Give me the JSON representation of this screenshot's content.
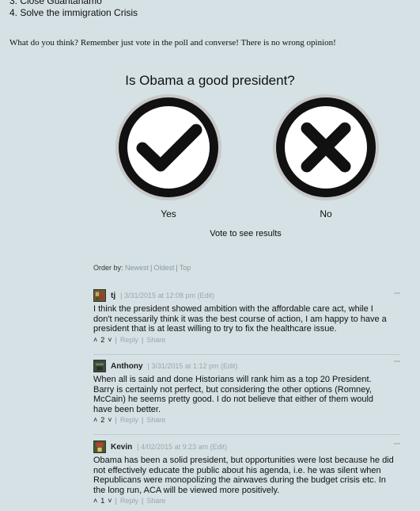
{
  "list": {
    "item3": "3. Close Guantanamo",
    "item4": "4. Solve the immigration Crisis"
  },
  "prompt": "What do you think? Remember just vote in the poll and converse! There is no wrong opinion!",
  "poll": {
    "question": "Is Obama a good president?",
    "yes_label": "Yes",
    "no_label": "No",
    "results_text": "Vote to see results"
  },
  "orderby": {
    "label": "Order by:",
    "newest": "Newest",
    "oldest": "Oldest",
    "top": "Top",
    "sep": "|"
  },
  "comments": [
    {
      "author": "tj",
      "meta": "3/31/2015 at 12:08 pm",
      "edit": "(Edit)",
      "text": "I think the president showed ambition with the affordable care act, while I don't necessarily think it was the best course of action, I am happy to have a president that is at least willing to try to fix the healthcare issue.",
      "votes": "2",
      "reply": "Reply",
      "share": "Share"
    },
    {
      "author": "Anthony",
      "meta": "3/31/2015 at 1:12 pm",
      "edit": "(Edit)",
      "text": "When all is said and done Historians will rank him as a top 20 President. Barry is certainly not perfect, but considering the other options (Romney, McCain) he seems pretty good. I do not believe that either of them would have been better.",
      "votes": "2",
      "reply": "Reply",
      "share": "Share"
    },
    {
      "author": "Kevin",
      "meta": "4/02/2015 at 9:23 am",
      "edit": "(Edit)",
      "text": "Obama has been a solid president, but opportunities were lost because he did not effectively educate the public about his agenda, i.e. he was silent when Republicans were monopolizing the airwaves during the budget crisis etc. In the long run, ACA will be viewed more positively.",
      "votes": "1",
      "reply": "Reply",
      "share": "Share"
    }
  ],
  "colors": {
    "background": "#d5e1e4",
    "link_muted": "#9aa6aa",
    "icon_ring": "#b8b8b8"
  }
}
